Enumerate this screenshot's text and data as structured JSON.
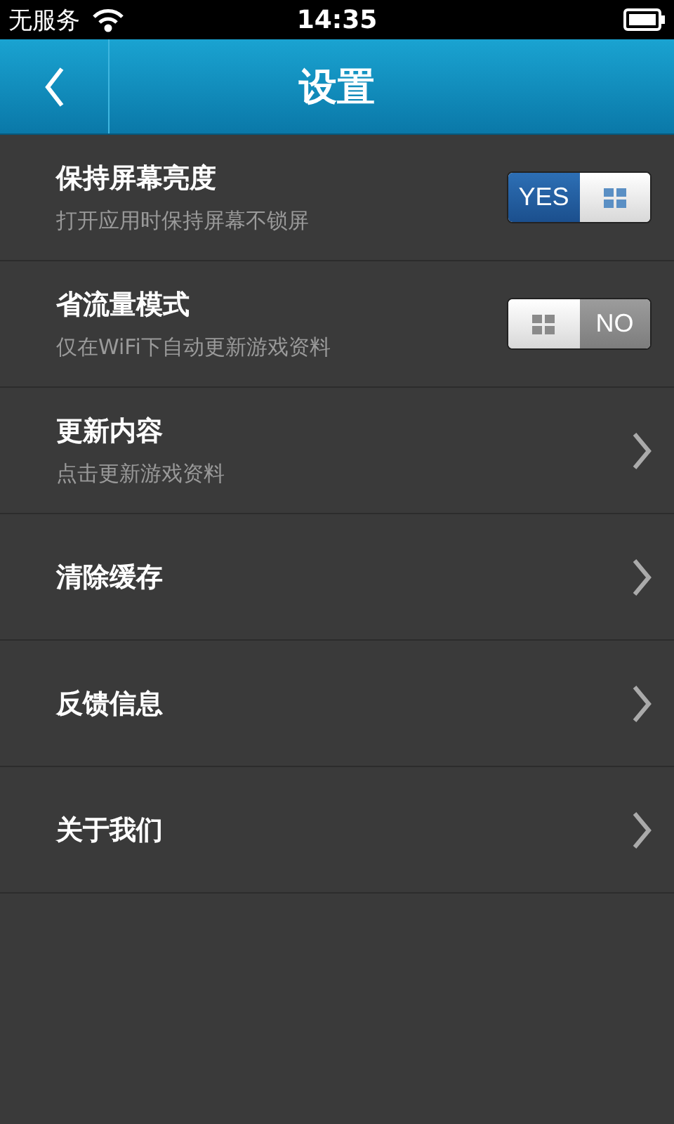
{
  "status_bar": {
    "carrier": "无服务",
    "time": "14:35"
  },
  "header": {
    "title": "设置"
  },
  "rows": [
    {
      "kind": "toggle",
      "title": "保持屏幕亮度",
      "subtitle": "打开应用时保持屏幕不锁屏",
      "on": true,
      "switch_label": "YES"
    },
    {
      "kind": "toggle",
      "title": "省流量模式",
      "subtitle": "仅在WiFi下自动更新游戏资料",
      "on": false,
      "switch_label": "NO"
    },
    {
      "kind": "link",
      "title": "更新内容",
      "subtitle": "点击更新游戏资料"
    },
    {
      "kind": "link",
      "title": "清除缓存"
    },
    {
      "kind": "link",
      "title": "反馈信息"
    },
    {
      "kind": "link",
      "title": "关于我们"
    }
  ]
}
